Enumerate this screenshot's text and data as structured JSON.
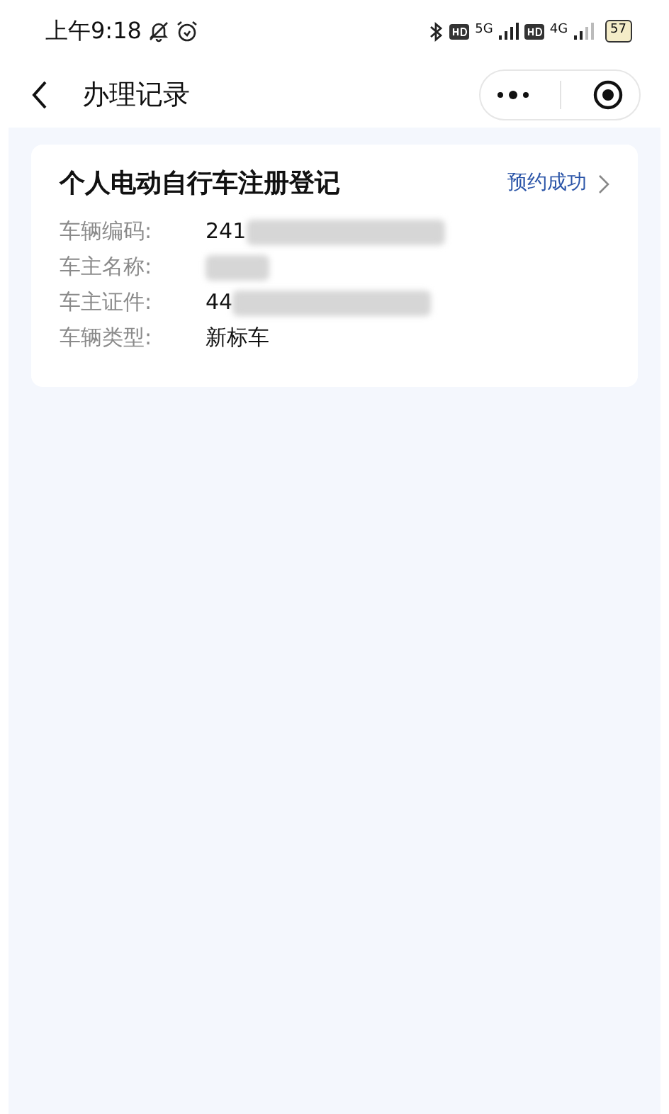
{
  "status_bar": {
    "time": "上午9:18",
    "network_1": "5G",
    "network_2": "4G",
    "battery": "57"
  },
  "nav_bar": {
    "title": "办理记录"
  },
  "records": [
    {
      "title": "个人电动自行车注册登记",
      "status": "预约成功",
      "fields": [
        {
          "label": "车辆编码:",
          "value": "241",
          "redacted": true
        },
        {
          "label": "车主名称:",
          "redacted": true
        },
        {
          "label": "车主证件:",
          "value": "44",
          "redacted": true
        },
        {
          "label": "车辆类型:",
          "value": "新标车"
        }
      ]
    }
  ]
}
